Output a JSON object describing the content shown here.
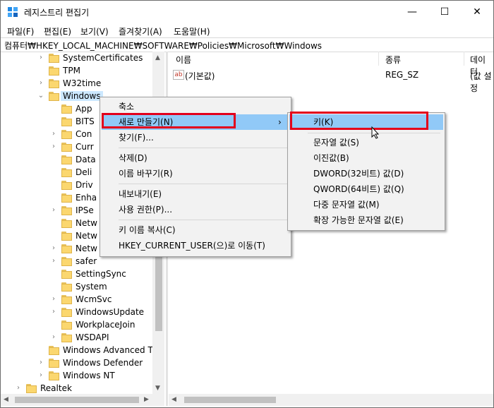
{
  "window": {
    "title": "레지스트리 편집기",
    "minimize": "—",
    "maximize": "☐",
    "close": "✕"
  },
  "menubar": [
    "파일(F)",
    "편집(E)",
    "보기(V)",
    "즐겨찾기(A)",
    "도움말(H)"
  ],
  "address": "컴퓨터₩HKEY_LOCAL_MACHINE₩SOFTWARE₩Policies₩Microsoft₩Windows",
  "tree": [
    {
      "label": "SystemCertificates",
      "expander": "›"
    },
    {
      "label": "TPM",
      "expander": ""
    },
    {
      "label": "W32time",
      "expander": "›"
    },
    {
      "label": "Windows",
      "expander": "⌄",
      "selected": true
    },
    {
      "label": "App",
      "expander": ""
    },
    {
      "label": "BITS",
      "expander": ""
    },
    {
      "label": "Con",
      "expander": "›"
    },
    {
      "label": "Curr",
      "expander": "›"
    },
    {
      "label": "Data",
      "expander": ""
    },
    {
      "label": "Deli",
      "expander": ""
    },
    {
      "label": "Driv",
      "expander": ""
    },
    {
      "label": "Enha",
      "expander": ""
    },
    {
      "label": "IPSe",
      "expander": "›"
    },
    {
      "label": "Netw",
      "expander": ""
    },
    {
      "label": "Netw",
      "expander": ""
    },
    {
      "label": "Netw",
      "expander": "›"
    },
    {
      "label": "safer",
      "expander": "›"
    },
    {
      "label": "SettingSync",
      "expander": ""
    },
    {
      "label": "System",
      "expander": ""
    },
    {
      "label": "WcmSvc",
      "expander": "›"
    },
    {
      "label": "WindowsUpdate",
      "expander": "›"
    },
    {
      "label": "WorkplaceJoin",
      "expander": ""
    },
    {
      "label": "WSDAPI",
      "expander": "›"
    },
    {
      "label": "Windows Advanced Thr",
      "expander": ""
    },
    {
      "label": "Windows Defender",
      "expander": "›"
    },
    {
      "label": "Windows NT",
      "expander": "›"
    },
    {
      "label": "Realtek",
      "expander": "›"
    }
  ],
  "list": {
    "headers": [
      "이름",
      "종류",
      "데이터"
    ],
    "rows": [
      {
        "icon": "ab",
        "name": "(기본값)",
        "type": "REG_SZ",
        "data": "(값 설정"
      }
    ]
  },
  "context_menu": [
    {
      "label": "축소"
    },
    {
      "label": "새로 만들기(N)",
      "submenu_arrow": "›",
      "highlighted": true
    },
    {
      "label": "찾기(F)..."
    },
    {
      "label": "삭제(D)"
    },
    {
      "label": "이름 바꾸기(R)"
    },
    {
      "label": "내보내기(E)"
    },
    {
      "label": "사용 권한(P)..."
    },
    {
      "label": "키 이름 복사(C)"
    },
    {
      "label": "HKEY_CURRENT_USER(으)로 이동(T)"
    }
  ],
  "submenu": [
    {
      "label": "키(K)",
      "highlighted": true
    },
    {
      "label": "문자열 값(S)"
    },
    {
      "label": "이진값(B)"
    },
    {
      "label": "DWORD(32비트) 값(D)"
    },
    {
      "label": "QWORD(64비트) 값(Q)"
    },
    {
      "label": "다중 문자열 값(M)"
    },
    {
      "label": "확장 가능한 문자열 값(E)"
    }
  ],
  "colors": {
    "highlight": "#91c9f7",
    "annotation_box": "#e3001b",
    "folder": "#fbd76f"
  }
}
